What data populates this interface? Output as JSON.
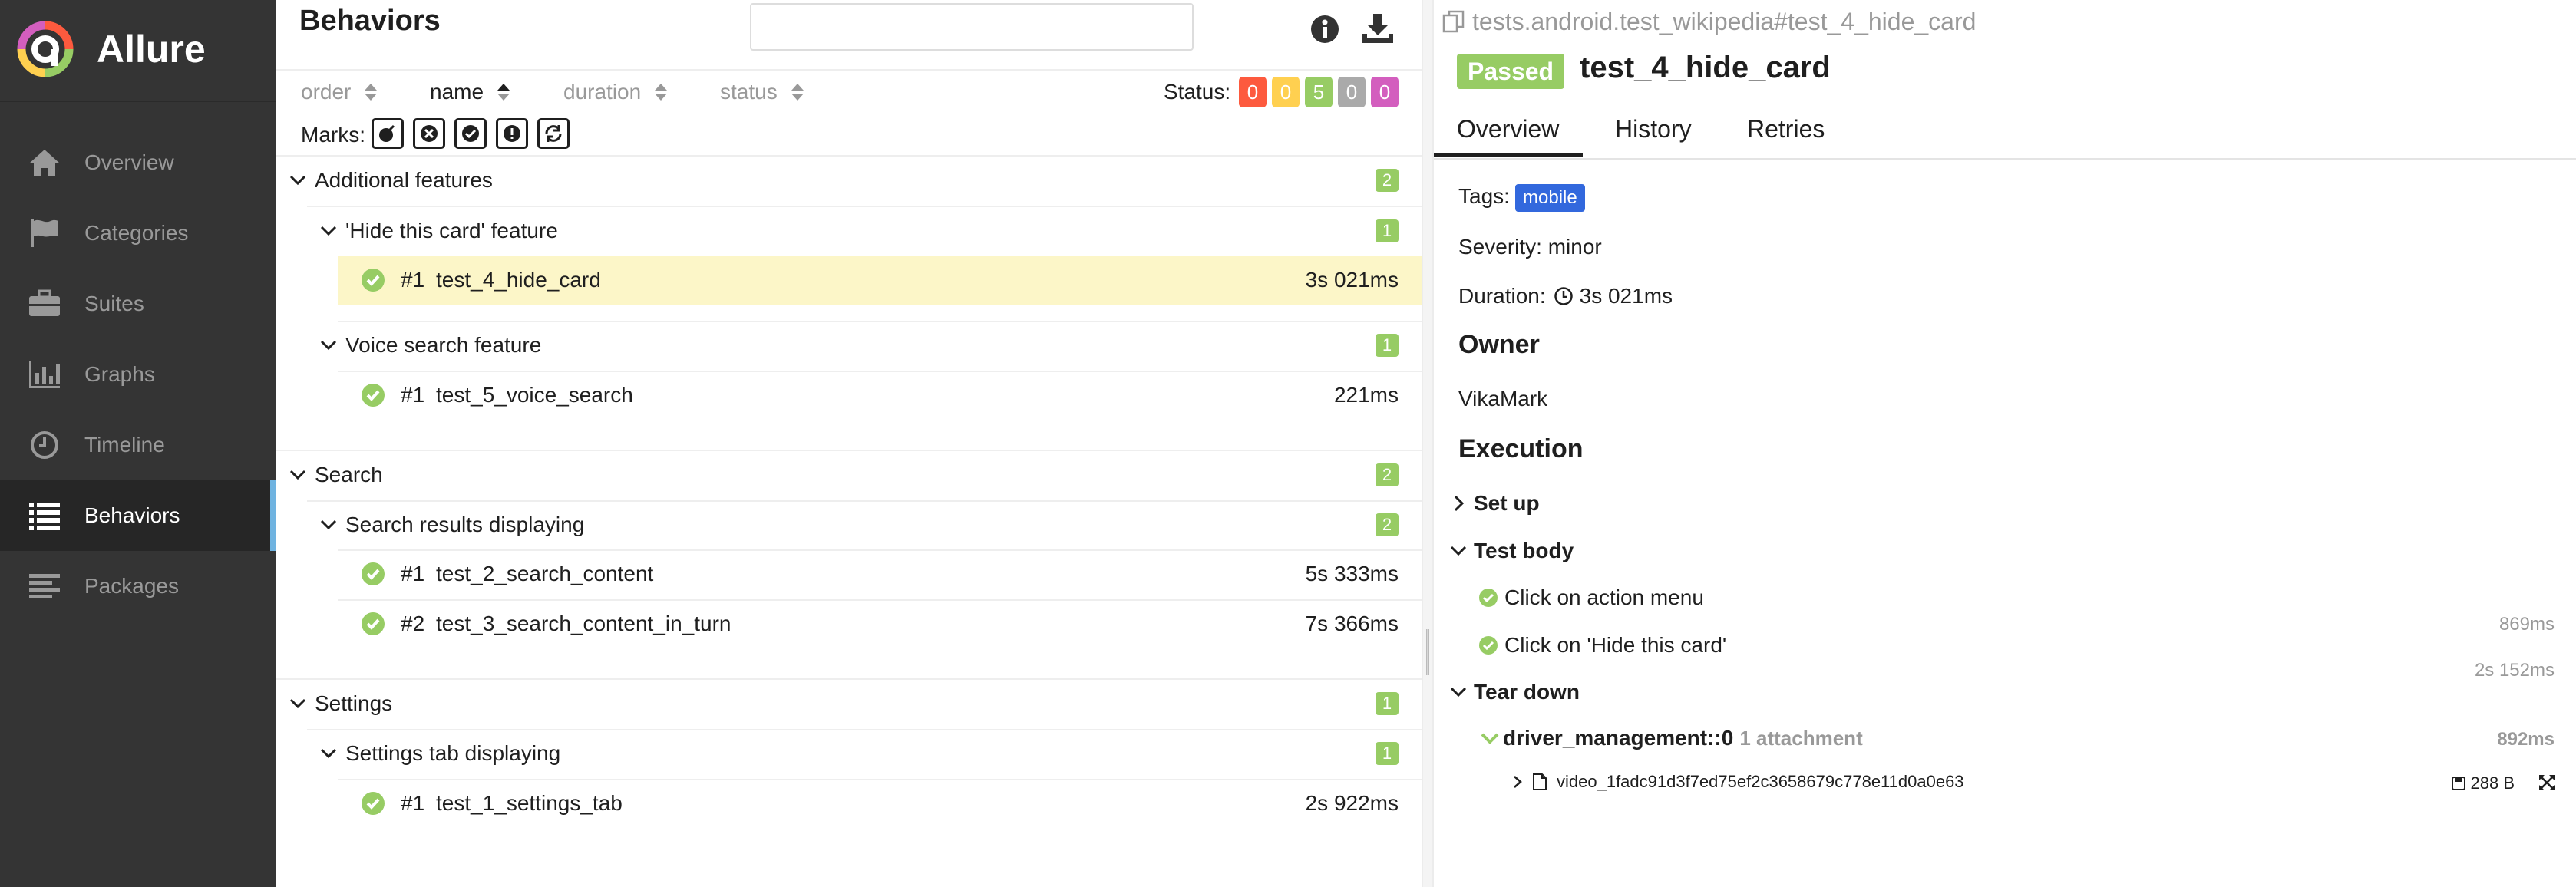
{
  "app": {
    "name": "Allure"
  },
  "sidebar": {
    "items": [
      {
        "label": "Overview",
        "icon": "home-icon"
      },
      {
        "label": "Categories",
        "icon": "flag-icon"
      },
      {
        "label": "Suites",
        "icon": "briefcase-icon"
      },
      {
        "label": "Graphs",
        "icon": "bar-chart-icon"
      },
      {
        "label": "Timeline",
        "icon": "clock-icon"
      },
      {
        "label": "Behaviors",
        "icon": "list-icon",
        "active": true
      },
      {
        "label": "Packages",
        "icon": "align-left-icon"
      }
    ]
  },
  "behaviors": {
    "title": "Behaviors",
    "search": {
      "value": "",
      "placeholder": ""
    },
    "sorters": [
      {
        "label": "order"
      },
      {
        "label": "name",
        "active": true
      },
      {
        "label": "duration"
      },
      {
        "label": "status"
      }
    ],
    "status_label": "Status:",
    "status_counts": [
      {
        "value": "0",
        "color": "#fd5a3e"
      },
      {
        "value": "0",
        "color": "#ffd050"
      },
      {
        "value": "5",
        "color": "#97cc64"
      },
      {
        "value": "0",
        "color": "#aaaaaa"
      },
      {
        "value": "0",
        "color": "#d35ebe"
      }
    ],
    "marks_label": "Marks:",
    "tree": {
      "epic1": {
        "label": "Additional features",
        "count": "2"
      },
      "feature1": {
        "label": "'Hide this card' feature",
        "count": "1"
      },
      "test1": {
        "num": "#1",
        "name": "test_4_hide_card",
        "duration": "3s 021ms"
      },
      "feature2": {
        "label": "Voice search feature",
        "count": "1"
      },
      "test2": {
        "num": "#1",
        "name": "test_5_voice_search",
        "duration": "221ms"
      },
      "epic2": {
        "label": "Search",
        "count": "2"
      },
      "feature3": {
        "label": "Search results displaying",
        "count": "2"
      },
      "test3": {
        "num": "#1",
        "name": "test_2_search_content",
        "duration": "5s 333ms"
      },
      "test4": {
        "num": "#2",
        "name": "test_3_search_content_in_turn",
        "duration": "7s 366ms"
      },
      "epic3": {
        "label": "Settings",
        "count": "1"
      },
      "feature4": {
        "label": "Settings tab displaying",
        "count": "1"
      },
      "test5": {
        "num": "#1",
        "name": "test_1_settings_tab",
        "duration": "2s 922ms"
      }
    }
  },
  "testcase": {
    "full_name": "tests.android.test_wikipedia#test_4_hide_card",
    "status": "Passed",
    "title": "test_4_hide_card",
    "tabs": [
      "Overview",
      "History",
      "Retries"
    ],
    "tags_label": "Tags:",
    "tag": "mobile",
    "severity": "Severity: minor",
    "duration_label": "Duration:",
    "duration": "3s 021ms",
    "owner_heading": "Owner",
    "owner": "VikaMark",
    "execution_heading": "Execution",
    "setup": "Set up",
    "test_body": "Test body",
    "steps": [
      {
        "label": "Click on action menu",
        "duration": "869ms"
      },
      {
        "label": "Click on 'Hide this card'",
        "duration": "2s 152ms"
      }
    ],
    "teardown": "Tear down",
    "driver": {
      "label": "driver_management::0",
      "attachments": "1 attachment",
      "duration": "892ms"
    },
    "attachment": {
      "name": "video_1fadc91d3f7ed75ef2c3658679c778e11d0a0e63",
      "size": "288 B"
    }
  }
}
